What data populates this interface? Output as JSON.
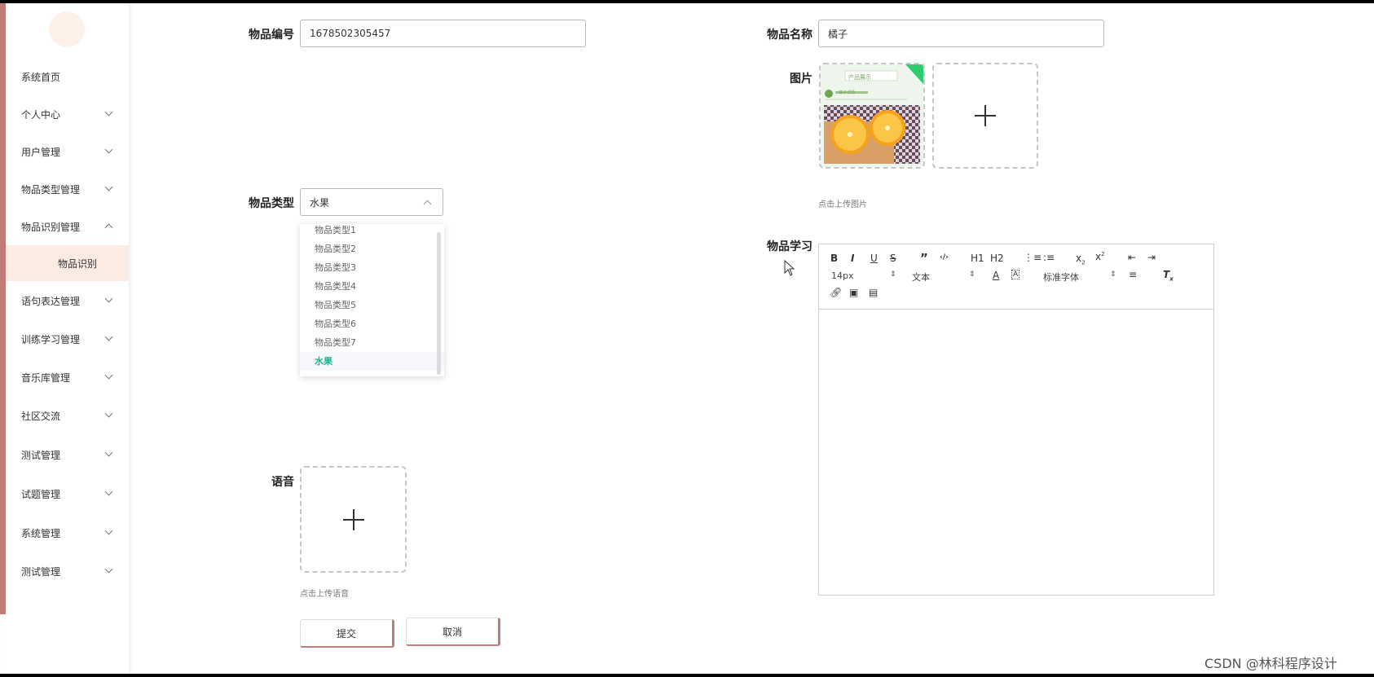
{
  "sidebar": {
    "items": [
      {
        "label": "系统首页"
      },
      {
        "label": "个人中心"
      },
      {
        "label": "用户管理"
      },
      {
        "label": "物品类型管理"
      },
      {
        "label": "物品识别管理"
      },
      {
        "label": "语句表达管理"
      },
      {
        "label": "训练学习管理"
      },
      {
        "label": "音乐库管理"
      },
      {
        "label": "社区交流"
      },
      {
        "label": "测试管理"
      },
      {
        "label": "试题管理"
      },
      {
        "label": "系统管理"
      },
      {
        "label": "测试管理"
      }
    ],
    "active_sub": "物品识别"
  },
  "form": {
    "item_no_label": "物品编号",
    "item_no_value": "1678502305457",
    "item_name_label": "物品名称",
    "item_name_value": "橘子",
    "image_label": "图片",
    "image_hint": "点击上传图片",
    "type_label": "物品类型",
    "type_value": "水果",
    "type_options": [
      "物品类型1",
      "物品类型2",
      "物品类型3",
      "物品类型4",
      "物品类型5",
      "物品类型6",
      "物品类型7",
      "水果"
    ],
    "study_label": "物品学习",
    "audio_label": "语音",
    "audio_hint": "点击上传语音",
    "submit": "提交",
    "cancel": "取消"
  },
  "thumb": {
    "banner": "产品展示",
    "caption": "橘子详情"
  },
  "editor": {
    "font_size": "14px",
    "heading": "文本",
    "font_family": "标准字体",
    "h1": "H1",
    "h2": "H2"
  },
  "watermark": "CSDN @林科程序设计",
  "colors": {
    "accent": "#c27b77",
    "active_option": "#1ab394",
    "submenu_bg": "#fcebe3"
  }
}
